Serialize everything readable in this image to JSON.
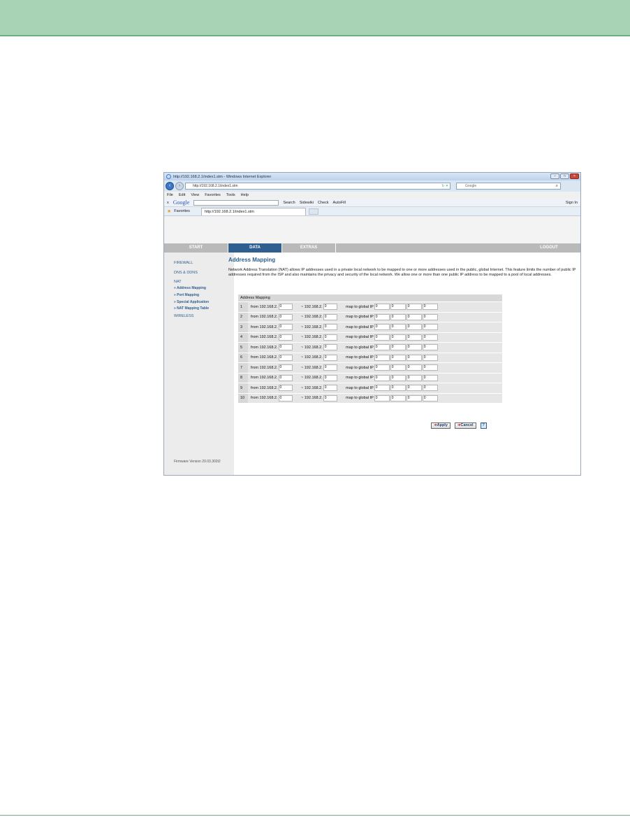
{
  "browser": {
    "title": "http://192.168.2.1/index1.stm - Windows Internet Explorer",
    "address": "http://192.168.2.1/index1.stm",
    "search_placeholder": "Google",
    "menu": [
      "File",
      "Edit",
      "View",
      "Favorites",
      "Tools",
      "Help"
    ],
    "google_toolbar": {
      "brand": "Google",
      "search": "Search",
      "sidewiki": "Sidewiki",
      "check": "Check",
      "autofill": "AutoFill",
      "signin": "Sign In"
    },
    "favorites_label": "Favorites",
    "tab_title": "http://192.168.2.1/index1.stm"
  },
  "nav": {
    "start": "START",
    "data": "DATA",
    "extras": "EXTRAS",
    "logout": "LOGOUT"
  },
  "sidebar": {
    "firewall": "FIREWALL",
    "dns": "DNS & DDNS",
    "nat": "NAT",
    "sub": [
      "» Address Mapping",
      "» Port Mapping",
      "» Special Application",
      "» NAT Mapping Table"
    ],
    "wireless": "WIRELESS",
    "firmware": "Firmware Version 20.03.302t2"
  },
  "content": {
    "title": "Address Mapping",
    "description": "Network Address Translation (NAT) allows IP addresses used in a private local network to be mapped to one or more addresses used in the public, global Internet. This feature limits the number of public IP addresses required from the ISP and also maintains the privacy and security of the local network. We allow one or more than one public IP address to be mapped to a pool of local addresses.",
    "table_header": "Address Mapping",
    "from_label": "from 192.168.2.",
    "to_label": "~ 192.168.2.",
    "map_label": "map to global IP",
    "rows": [
      {
        "num": "1",
        "from": "0",
        "to": "0",
        "ip": [
          "0",
          "0",
          "0",
          "0"
        ]
      },
      {
        "num": "2",
        "from": "0",
        "to": "0",
        "ip": [
          "0",
          "0",
          "0",
          "0"
        ]
      },
      {
        "num": "3",
        "from": "0",
        "to": "0",
        "ip": [
          "0",
          "0",
          "0",
          "0"
        ]
      },
      {
        "num": "4",
        "from": "0",
        "to": "0",
        "ip": [
          "0",
          "0",
          "0",
          "0"
        ]
      },
      {
        "num": "5",
        "from": "0",
        "to": "0",
        "ip": [
          "0",
          "0",
          "0",
          "0"
        ]
      },
      {
        "num": "6",
        "from": "0",
        "to": "0",
        "ip": [
          "0",
          "0",
          "0",
          "0"
        ]
      },
      {
        "num": "7",
        "from": "0",
        "to": "0",
        "ip": [
          "0",
          "0",
          "0",
          "0"
        ]
      },
      {
        "num": "8",
        "from": "0",
        "to": "0",
        "ip": [
          "0",
          "0",
          "0",
          "0"
        ]
      },
      {
        "num": "9",
        "from": "0",
        "to": "0",
        "ip": [
          "0",
          "0",
          "0",
          "0"
        ]
      },
      {
        "num": "10",
        "from": "0",
        "to": "0",
        "ip": [
          "0",
          "0",
          "0",
          "0"
        ]
      }
    ],
    "apply": "Apply",
    "cancel": "Cancel",
    "help": "?"
  }
}
